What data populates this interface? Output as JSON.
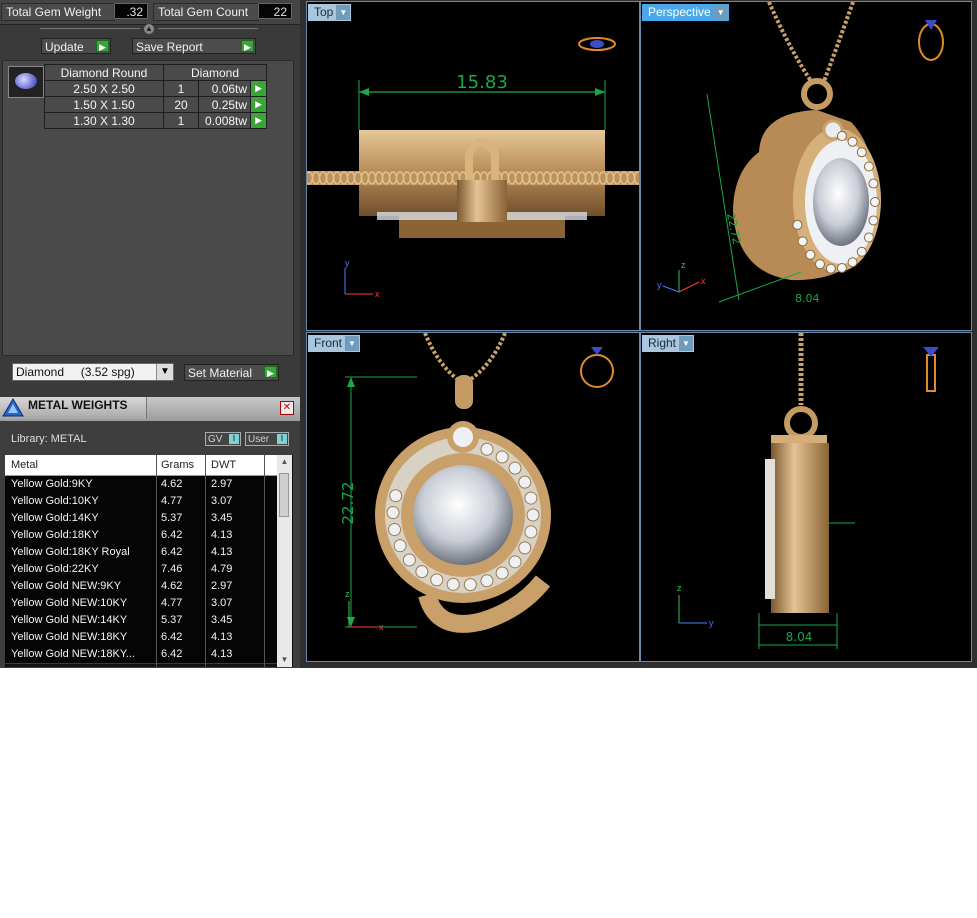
{
  "gem_summary": {
    "weight_label": "Total Gem Weight",
    "weight_value": ".32",
    "count_label": "Total Gem Count",
    "count_value": "22"
  },
  "actions": {
    "update_label": "Update",
    "save_report_label": "Save Report"
  },
  "gem_table": {
    "headers": [
      "Diamond Round",
      "Diamond"
    ],
    "rows": [
      {
        "size": "2.50 X 2.50",
        "count": "1",
        "weight": "0.06tw"
      },
      {
        "size": "1.50 X 1.50",
        "count": "20",
        "weight": "0.25tw"
      },
      {
        "size": "1.30 X 1.30",
        "count": "1",
        "weight": "0.008tw"
      }
    ]
  },
  "material": {
    "selected": "Diamond     (3.52 spg)",
    "set_label": "Set Material"
  },
  "metal_weights": {
    "title": "METAL WEIGHTS",
    "library": "Library: METAL",
    "toggle_gv": "GV",
    "toggle_user": "User",
    "columns": [
      "Metal",
      "Grams",
      "DWT"
    ],
    "rows": [
      {
        "metal": "Yellow Gold:9KY",
        "grams": "4.62",
        "dwt": "2.97"
      },
      {
        "metal": "Yellow Gold:10KY",
        "grams": "4.77",
        "dwt": "3.07"
      },
      {
        "metal": "Yellow Gold:14KY",
        "grams": "5.37",
        "dwt": "3.45"
      },
      {
        "metal": "Yellow Gold:18KY",
        "grams": "6.42",
        "dwt": "4.13"
      },
      {
        "metal": "Yellow Gold:18KY Royal",
        "grams": "6.42",
        "dwt": "4.13"
      },
      {
        "metal": "Yellow Gold:22KY",
        "grams": "7.46",
        "dwt": "4.79"
      },
      {
        "metal": "Yellow Gold NEW:9KY",
        "grams": "4.62",
        "dwt": "2.97"
      },
      {
        "metal": "Yellow Gold NEW:10KY",
        "grams": "4.77",
        "dwt": "3.07"
      },
      {
        "metal": "Yellow Gold NEW:14KY",
        "grams": "5.37",
        "dwt": "3.45"
      },
      {
        "metal": "Yellow Gold NEW:18KY",
        "grams": "6.42",
        "dwt": "4.13"
      },
      {
        "metal": "Yellow Gold NEW:18KY...",
        "grams": "6.42",
        "dwt": "4.13"
      }
    ]
  },
  "viewports": {
    "top": {
      "label": "Top",
      "dimension": "15.83"
    },
    "perspective": {
      "label": "Perspective",
      "dimension_a": "22.72",
      "dimension_b": "8.04"
    },
    "front": {
      "label": "Front",
      "dimension": "22.72"
    },
    "right": {
      "label": "Right",
      "dimension": "8.04"
    }
  },
  "colors": {
    "gold": "#c9a06a",
    "dimension_line": "#19a84a",
    "viewport_border": "#6a8aa8",
    "active_tab": "#4aa8e8"
  }
}
